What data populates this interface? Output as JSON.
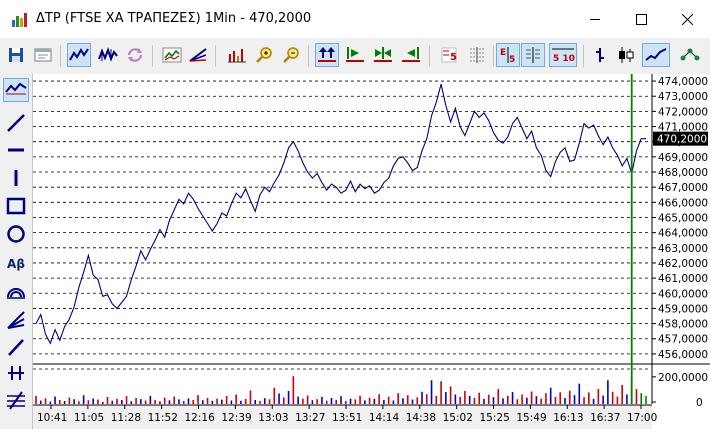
{
  "window": {
    "title": "ΔΤΡ (FTSE ΧΑ ΤΡΑΠΕΖΕΣ) 1Min - 470,2000",
    "minimize_icon": "minimize-icon",
    "maximize_icon": "maximize-icon",
    "close_icon": "close-icon"
  },
  "toolbar": {
    "items": [
      {
        "name": "save-icon",
        "selected": false
      },
      {
        "name": "window-icon",
        "selected": false
      },
      {
        "name": "line-chart-icon",
        "selected": true
      },
      {
        "name": "ohlc-chart-icon",
        "selected": false
      },
      {
        "name": "refresh-icon",
        "selected": false
      },
      {
        "name": "indicator-chart-icon",
        "selected": false
      },
      {
        "name": "fan-tool-icon",
        "selected": false
      },
      {
        "name": "volume-bars-icon",
        "selected": false
      },
      {
        "name": "zoom-in-icon",
        "selected": false
      },
      {
        "name": "zoom-out-icon",
        "selected": false
      },
      {
        "name": "scroll-both-icon",
        "selected": true
      },
      {
        "name": "scroll-right-icon",
        "selected": false
      },
      {
        "name": "scroll-center-icon",
        "selected": false
      },
      {
        "name": "scroll-left-icon",
        "selected": false
      },
      {
        "name": "period-5-icon",
        "selected": false
      },
      {
        "name": "grid-icon",
        "selected": false
      },
      {
        "name": "decimal-icon",
        "selected": true
      },
      {
        "name": "table-icon",
        "selected": true
      },
      {
        "name": "range-510-icon",
        "selected": true
      },
      {
        "name": "bar-style-icon",
        "selected": false
      },
      {
        "name": "candle-style-icon",
        "selected": false
      },
      {
        "name": "line-style-icon",
        "selected": true
      },
      {
        "name": "network-icon",
        "selected": false
      }
    ],
    "labels": {
      "period": "5",
      "decimal_top": "E",
      "decimal_bottom": "5",
      "range": "5 10"
    }
  },
  "drawing_tools": {
    "items": [
      {
        "name": "trend-line-icon",
        "selected": true
      },
      {
        "name": "diagonal-line-icon",
        "selected": false
      },
      {
        "name": "horizontal-line-icon",
        "selected": false
      },
      {
        "name": "vertical-line-icon",
        "selected": false
      },
      {
        "name": "rectangle-icon",
        "selected": false
      },
      {
        "name": "ellipse-icon",
        "selected": false
      },
      {
        "name": "text-tool-icon",
        "selected": false
      },
      {
        "name": "arc-tool-icon",
        "selected": false
      },
      {
        "name": "fan-tool-icon",
        "selected": false
      },
      {
        "name": "ray-line-icon",
        "selected": false
      },
      {
        "name": "parallel-lines-icon",
        "selected": false
      },
      {
        "name": "fibonacci-icon",
        "selected": false
      }
    ],
    "text_label": "Aβ"
  },
  "chart_data": {
    "type": "line",
    "title": "",
    "price_axis": {
      "min": 455.4,
      "max": 474.4,
      "ticks": [
        "474,0000",
        "473,0000",
        "472,0000",
        "471,0000",
        "470,0000",
        "469,0000",
        "468,0000",
        "467,0000",
        "466,0000",
        "465,0000",
        "464,0000",
        "463,0000",
        "462,0000",
        "461,0000",
        "460,0000",
        "459,0000",
        "458,0000",
        "457,0000",
        "456,0000"
      ],
      "tick_values": [
        474,
        473,
        472,
        471,
        470,
        469,
        468,
        467,
        466,
        465,
        464,
        463,
        462,
        461,
        460,
        459,
        458,
        457,
        456
      ],
      "current_label": "470,2000",
      "current_value": 470.2
    },
    "volume_axis": {
      "ticks": [
        "200,0000",
        "0"
      ],
      "tick_values": [
        200000,
        0
      ],
      "max": 280000
    },
    "x_axis": {
      "labels": [
        "10:41",
        "11:05",
        "11:28",
        "11:52",
        "12:16",
        "12:39",
        "13:03",
        "13:27",
        "13:51",
        "14:14",
        "14:38",
        "15:02",
        "15:25",
        "15:49",
        "16:13",
        "16:37",
        "17:00"
      ]
    },
    "cursor_time": "17:00",
    "grid": true,
    "colors": {
      "price_line": "#000080",
      "volume_up": "#0000cc",
      "volume_down": "#cc0000",
      "volume_neutral": "#008000",
      "cursor": "#008000",
      "current_price_bg": "#000000",
      "current_price_text": "#ffffff"
    },
    "price_series": [
      [
        0,
        458.0
      ],
      [
        1,
        458.6
      ],
      [
        2,
        457.3
      ],
      [
        3,
        456.7
      ],
      [
        4,
        457.6
      ],
      [
        5,
        456.9
      ],
      [
        6,
        457.8
      ],
      [
        7,
        458.3
      ],
      [
        8,
        459.1
      ],
      [
        9,
        460.4
      ],
      [
        10,
        461.4
      ],
      [
        11,
        462.5
      ],
      [
        12,
        461.2
      ],
      [
        13,
        460.9
      ],
      [
        14,
        459.8
      ],
      [
        15,
        459.9
      ],
      [
        16,
        459.3
      ],
      [
        17,
        459.0
      ],
      [
        18,
        459.4
      ],
      [
        19,
        459.8
      ],
      [
        20,
        460.9
      ],
      [
        21,
        461.8
      ],
      [
        22,
        462.8
      ],
      [
        23,
        462.2
      ],
      [
        24,
        462.9
      ],
      [
        25,
        463.5
      ],
      [
        26,
        464.2
      ],
      [
        27,
        463.7
      ],
      [
        28,
        464.8
      ],
      [
        29,
        465.5
      ],
      [
        30,
        466.2
      ],
      [
        31,
        465.9
      ],
      [
        32,
        466.6
      ],
      [
        33,
        466.2
      ],
      [
        34,
        465.6
      ],
      [
        35,
        465.1
      ],
      [
        36,
        464.6
      ],
      [
        37,
        464.1
      ],
      [
        38,
        464.6
      ],
      [
        39,
        465.3
      ],
      [
        40,
        465.1
      ],
      [
        41,
        465.9
      ],
      [
        42,
        466.6
      ],
      [
        43,
        466.3
      ],
      [
        44,
        466.9
      ],
      [
        45,
        466.1
      ],
      [
        46,
        465.4
      ],
      [
        47,
        466.5
      ],
      [
        48,
        467.0
      ],
      [
        49,
        466.7
      ],
      [
        50,
        467.3
      ],
      [
        51,
        467.8
      ],
      [
        52,
        468.6
      ],
      [
        53,
        469.6
      ],
      [
        54,
        470.0
      ],
      [
        55,
        469.4
      ],
      [
        56,
        468.6
      ],
      [
        57,
        468.0
      ],
      [
        58,
        467.6
      ],
      [
        59,
        467.9
      ],
      [
        60,
        467.3
      ],
      [
        61,
        466.8
      ],
      [
        62,
        467.2
      ],
      [
        63,
        467.0
      ],
      [
        64,
        466.6
      ],
      [
        65,
        466.8
      ],
      [
        66,
        467.4
      ],
      [
        67,
        466.7
      ],
      [
        68,
        467.2
      ],
      [
        69,
        466.9
      ],
      [
        70,
        467.1
      ],
      [
        71,
        466.6
      ],
      [
        72,
        466.8
      ],
      [
        73,
        467.3
      ],
      [
        74,
        467.6
      ],
      [
        75,
        468.4
      ],
      [
        76,
        468.9
      ],
      [
        77,
        469.0
      ],
      [
        78,
        468.6
      ],
      [
        79,
        468.1
      ],
      [
        80,
        468.3
      ],
      [
        81,
        469.4
      ],
      [
        82,
        470.2
      ],
      [
        83,
        471.7
      ],
      [
        84,
        472.6
      ],
      [
        85,
        473.8
      ],
      [
        86,
        472.4
      ],
      [
        87,
        471.3
      ],
      [
        88,
        472.2
      ],
      [
        89,
        471.0
      ],
      [
        90,
        470.4
      ],
      [
        91,
        471.2
      ],
      [
        92,
        472.0
      ],
      [
        93,
        471.6
      ],
      [
        94,
        471.9
      ],
      [
        95,
        471.4
      ],
      [
        96,
        470.6
      ],
      [
        97,
        470.1
      ],
      [
        98,
        469.9
      ],
      [
        99,
        470.3
      ],
      [
        100,
        471.2
      ],
      [
        101,
        471.6
      ],
      [
        102,
        470.9
      ],
      [
        103,
        470.2
      ],
      [
        104,
        470.7
      ],
      [
        105,
        469.6
      ],
      [
        106,
        469.1
      ],
      [
        107,
        468.1
      ],
      [
        108,
        467.7
      ],
      [
        109,
        468.7
      ],
      [
        110,
        469.3
      ],
      [
        111,
        469.6
      ],
      [
        112,
        468.7
      ],
      [
        113,
        468.8
      ],
      [
        114,
        469.9
      ],
      [
        115,
        471.2
      ],
      [
        116,
        470.9
      ],
      [
        117,
        471.1
      ],
      [
        118,
        470.4
      ],
      [
        119,
        469.8
      ],
      [
        120,
        470.3
      ],
      [
        121,
        469.6
      ],
      [
        122,
        469.1
      ],
      [
        123,
        468.4
      ],
      [
        124,
        468.9
      ],
      [
        125,
        467.9
      ],
      [
        126,
        469.4
      ],
      [
        127,
        470.2
      ],
      [
        128,
        470.2
      ]
    ],
    "volume_series": [
      [
        0,
        60000,
        "d"
      ],
      [
        1,
        25000,
        "u"
      ],
      [
        2,
        42000,
        "d"
      ],
      [
        3,
        18000,
        "u"
      ],
      [
        4,
        55000,
        "u"
      ],
      [
        5,
        30000,
        "d"
      ],
      [
        6,
        22000,
        "u"
      ],
      [
        7,
        48000,
        "d"
      ],
      [
        8,
        35000,
        "u"
      ],
      [
        9,
        20000,
        "d"
      ],
      [
        10,
        64000,
        "u"
      ],
      [
        11,
        28000,
        "d"
      ],
      [
        12,
        40000,
        "u"
      ],
      [
        13,
        33000,
        "d"
      ],
      [
        14,
        15000,
        "u"
      ],
      [
        15,
        52000,
        "d"
      ],
      [
        16,
        24000,
        "u"
      ],
      [
        17,
        38000,
        "d"
      ],
      [
        18,
        29000,
        "u"
      ],
      [
        19,
        58000,
        "d"
      ],
      [
        20,
        21000,
        "u"
      ],
      [
        21,
        44000,
        "d"
      ],
      [
        22,
        36000,
        "u"
      ],
      [
        23,
        26000,
        "d"
      ],
      [
        24,
        60000,
        "u"
      ],
      [
        25,
        31000,
        "d"
      ],
      [
        26,
        19000,
        "u"
      ],
      [
        27,
        47000,
        "d"
      ],
      [
        28,
        27000,
        "u"
      ],
      [
        29,
        55000,
        "d"
      ],
      [
        30,
        34000,
        "u"
      ],
      [
        31,
        22000,
        "d"
      ],
      [
        32,
        41000,
        "u"
      ],
      [
        33,
        30000,
        "d"
      ],
      [
        34,
        66000,
        "d"
      ],
      [
        35,
        28000,
        "u"
      ],
      [
        36,
        45000,
        "d"
      ],
      [
        37,
        23000,
        "u"
      ],
      [
        38,
        39000,
        "d"
      ],
      [
        39,
        32000,
        "u"
      ],
      [
        40,
        59000,
        "d"
      ],
      [
        41,
        26000,
        "u"
      ],
      [
        42,
        70000,
        "d"
      ],
      [
        43,
        24000,
        "u"
      ],
      [
        44,
        37000,
        "d"
      ],
      [
        45,
        100000,
        "d"
      ],
      [
        46,
        30000,
        "u"
      ],
      [
        47,
        22000,
        "d"
      ],
      [
        48,
        43000,
        "u"
      ],
      [
        49,
        35000,
        "d"
      ],
      [
        50,
        120000,
        "d"
      ],
      [
        51,
        78000,
        "u"
      ],
      [
        52,
        48000,
        "d"
      ],
      [
        53,
        96000,
        "u"
      ],
      [
        54,
        205000,
        "d"
      ],
      [
        55,
        55000,
        "u"
      ],
      [
        56,
        40000,
        "d"
      ],
      [
        57,
        63000,
        "d"
      ],
      [
        58,
        28000,
        "u"
      ],
      [
        59,
        36000,
        "d"
      ],
      [
        60,
        52000,
        "u"
      ],
      [
        61,
        25000,
        "d"
      ],
      [
        62,
        44000,
        "u"
      ],
      [
        63,
        31000,
        "d"
      ],
      [
        64,
        58000,
        "u"
      ],
      [
        65,
        22000,
        "d"
      ],
      [
        66,
        40000,
        "u"
      ],
      [
        67,
        34000,
        "d"
      ],
      [
        68,
        61000,
        "d"
      ],
      [
        69,
        27000,
        "u"
      ],
      [
        70,
        46000,
        "d"
      ],
      [
        71,
        38000,
        "u"
      ],
      [
        72,
        72000,
        "d"
      ],
      [
        73,
        30000,
        "u"
      ],
      [
        74,
        54000,
        "d"
      ],
      [
        75,
        26000,
        "u"
      ],
      [
        76,
        80000,
        "d"
      ],
      [
        77,
        42000,
        "u"
      ],
      [
        78,
        65000,
        "d"
      ],
      [
        79,
        33000,
        "u"
      ],
      [
        80,
        49000,
        "d"
      ],
      [
        81,
        90000,
        "u"
      ],
      [
        82,
        72000,
        "d"
      ],
      [
        83,
        175000,
        "u"
      ],
      [
        84,
        60000,
        "d"
      ],
      [
        85,
        168000,
        "d"
      ],
      [
        86,
        88000,
        "u"
      ],
      [
        87,
        130000,
        "d"
      ],
      [
        88,
        70000,
        "u"
      ],
      [
        89,
        52000,
        "d"
      ],
      [
        90,
        96000,
        "d"
      ],
      [
        91,
        60000,
        "u"
      ],
      [
        92,
        45000,
        "d"
      ],
      [
        93,
        83000,
        "d"
      ],
      [
        94,
        38000,
        "u"
      ],
      [
        95,
        68000,
        "d"
      ],
      [
        96,
        50000,
        "u"
      ],
      [
        97,
        110000,
        "d"
      ],
      [
        98,
        42000,
        "u"
      ],
      [
        99,
        60000,
        "d"
      ],
      [
        100,
        88000,
        "u"
      ],
      [
        101,
        35000,
        "d"
      ],
      [
        102,
        70000,
        "d"
      ],
      [
        103,
        46000,
        "u"
      ],
      [
        104,
        92000,
        "d"
      ],
      [
        105,
        58000,
        "u"
      ],
      [
        106,
        40000,
        "d"
      ],
      [
        107,
        80000,
        "d"
      ],
      [
        108,
        120000,
        "u"
      ],
      [
        109,
        52000,
        "d"
      ],
      [
        110,
        86000,
        "d"
      ],
      [
        111,
        44000,
        "u"
      ],
      [
        112,
        98000,
        "d"
      ],
      [
        113,
        65000,
        "u"
      ],
      [
        114,
        150000,
        "u"
      ],
      [
        115,
        50000,
        "d"
      ],
      [
        116,
        85000,
        "d"
      ],
      [
        117,
        38000,
        "u"
      ],
      [
        118,
        110000,
        "d"
      ],
      [
        119,
        62000,
        "u"
      ],
      [
        120,
        175000,
        "u"
      ],
      [
        121,
        90000,
        "d"
      ],
      [
        122,
        55000,
        "d"
      ],
      [
        123,
        140000,
        "d"
      ],
      [
        124,
        70000,
        "u"
      ],
      [
        125,
        160000,
        "u"
      ],
      [
        126,
        110000,
        "d"
      ],
      [
        127,
        80000,
        "n"
      ],
      [
        128,
        60000,
        "n"
      ]
    ]
  }
}
